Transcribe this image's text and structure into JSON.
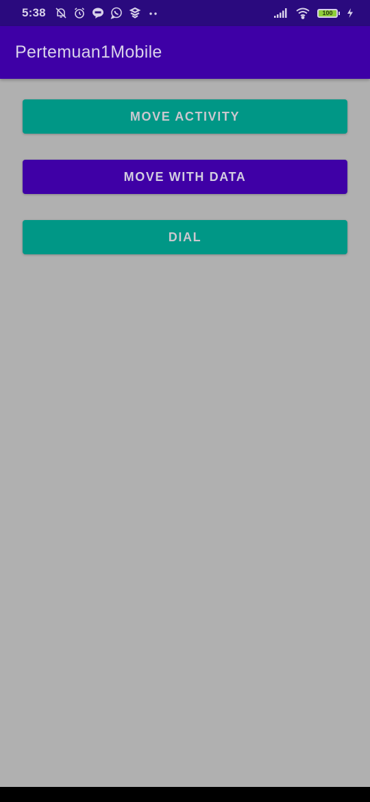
{
  "status_bar": {
    "time": "5:38",
    "battery_level": "100",
    "left_icons": [
      "bell-muted-icon",
      "alarm-icon",
      "line-icon",
      "whatsapp-icon",
      "app-icon",
      "more-dots-icon"
    ],
    "right_icons": [
      "signal-icon",
      "wifi-icon",
      "battery-icon",
      "charging-icon"
    ]
  },
  "app_bar": {
    "title": "Pertemuan1Mobile"
  },
  "buttons": {
    "move_activity": "MOVE ACTIVITY",
    "move_with_data": "MOVE WITH DATA",
    "dial": "DIAL"
  },
  "colors": {
    "status_bar": "#2a0a7e",
    "app_bar": "#3e00a6",
    "teal_button": "#009786",
    "purple_button": "#3f00a6",
    "background": "#b0b0b0"
  }
}
